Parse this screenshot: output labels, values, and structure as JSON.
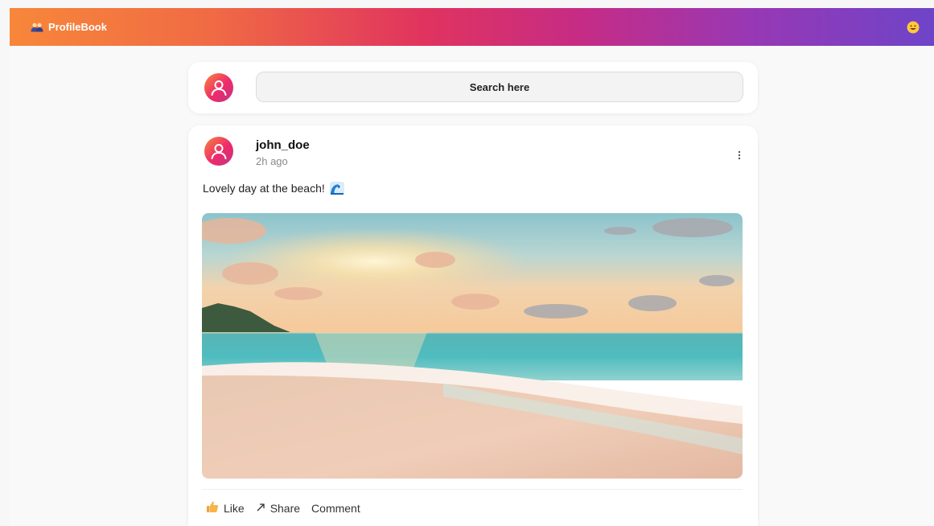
{
  "navbar": {
    "brand_label": "ProfileBook",
    "brand_icon": "people-icon",
    "emoji_icon": "smiley-face-icon"
  },
  "search": {
    "placeholder": "Search here",
    "avatar_icon": "user-avatar-icon"
  },
  "post": {
    "username": "john_doe",
    "time": "2h ago",
    "caption": "Lovely day at the beach!",
    "caption_icon": "wave-icon",
    "image_alt": "beach sunset photo",
    "actions": {
      "like_label": "Like",
      "share_label": "Share",
      "comment_label": "Comment"
    }
  },
  "colors": {
    "gradient_start": "#f7873a",
    "gradient_mid": "#e0335f",
    "gradient_end": "#6e44c8",
    "avatar_pink": "#ee2a6b"
  }
}
